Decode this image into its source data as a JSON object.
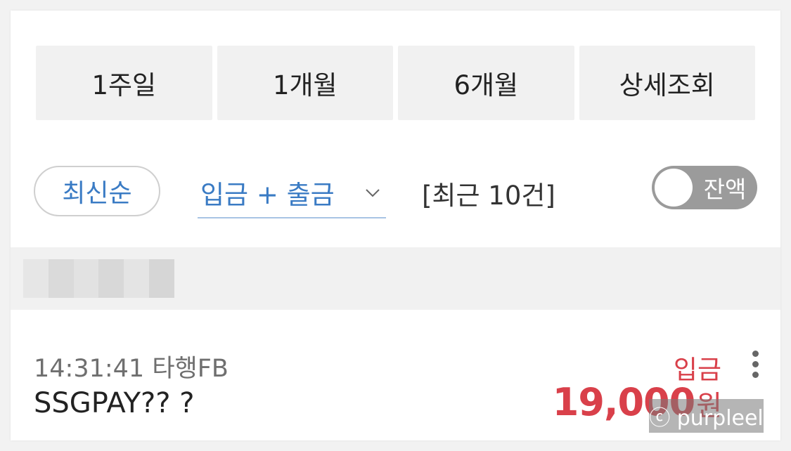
{
  "period_buttons": [
    "1주일",
    "1개월",
    "6개월",
    "상세조회"
  ],
  "filters": {
    "sort_label": "최신순",
    "type_label": "입금 + 출금",
    "recent_count": "[최근 10건]",
    "balance_toggle_label": "잔액",
    "balance_toggle_on": false
  },
  "date_band": {
    "blurred": true
  },
  "transaction": {
    "time_branch": "14:31:41 타행FB",
    "description": "SSGPAY?? ?",
    "type": "입금",
    "amount": "19,000",
    "currency": "원"
  },
  "watermark": "ⓒ purpleel",
  "colors": {
    "accent_blue": "#3a7bc4",
    "deposit_red": "#d9404a",
    "button_bg": "#f1f1f1",
    "toggle_bg": "#9b9b9b"
  },
  "icons": {
    "type_select": "chevron-down-icon",
    "menu": "kebab-menu-icon"
  }
}
